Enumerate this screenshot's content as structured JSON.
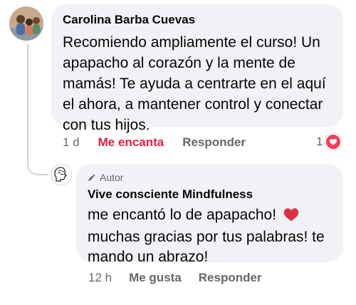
{
  "comments": [
    {
      "author": "Carolina Barba Cuevas",
      "text": "Recomiendo ampliamente el curso! Un apapacho al corazón y la mente de mamás! Te ayuda a centrarte en el aquí el ahora, a mantener control y conectar con tus hijos.",
      "time": "1 d",
      "reaction_label": "Me encanta",
      "reply_label": "Responder",
      "reaction_count": "1",
      "reaction_icon": "heart-reaction-icon",
      "reaction_color": "#e41e3f"
    }
  ],
  "reply": {
    "badge": "Autor",
    "badge_icon": "pencil-icon",
    "author": "Vive consciente Mindfulness",
    "text": "me encantó lo de apapacho! ",
    "text_emoji": "red-heart-emoji",
    "text_2": "muchas gracias por tus palabras! te mando un abrazo!",
    "time": "12 h",
    "like_label": "Me gusta",
    "reply_label": "Responder"
  },
  "colors": {
    "bubble": "#f0f2f5",
    "secondary_text": "#65676b",
    "love_red": "#e41e3f"
  }
}
